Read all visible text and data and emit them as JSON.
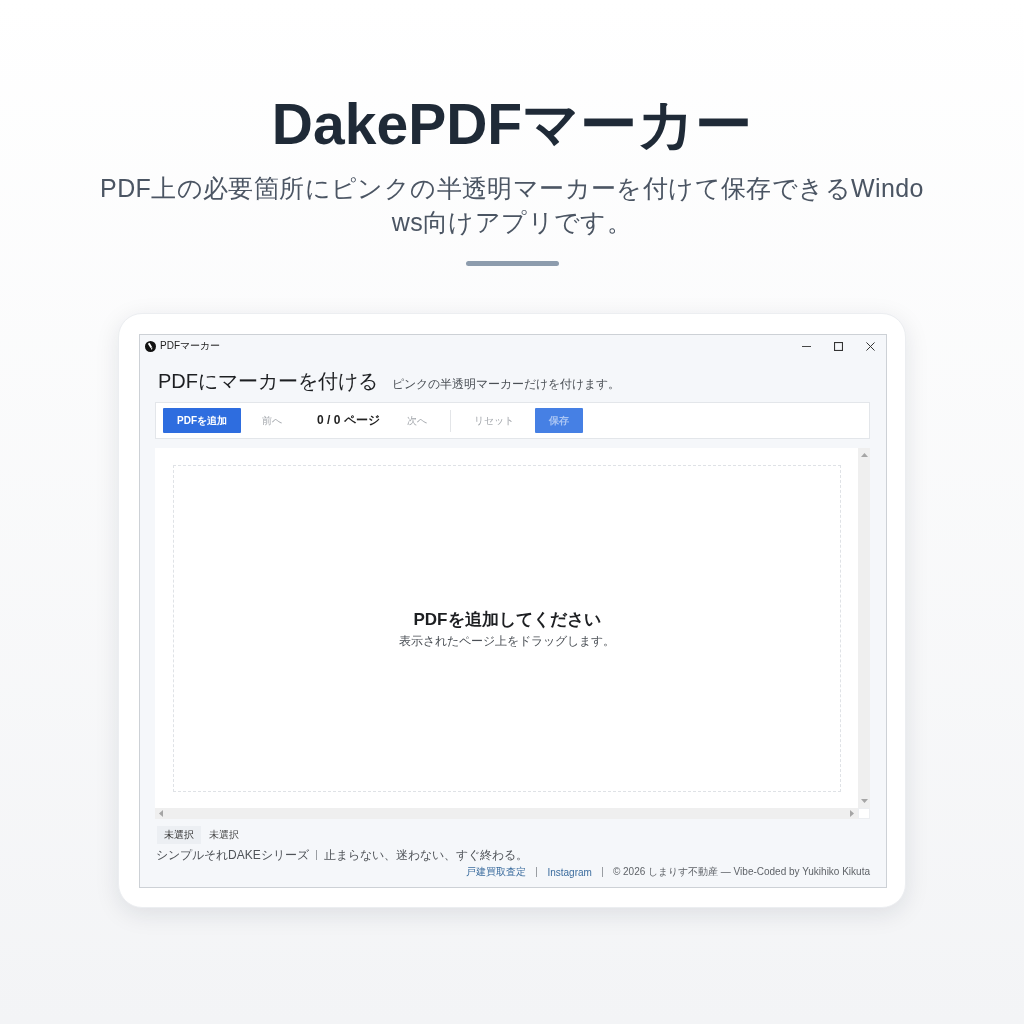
{
  "hero": {
    "title": "DakePDFマーカー",
    "subtitle": "PDF上の必要箇所にピンクの半透明マーカーを付けて保存できるWindows向けアプリです。"
  },
  "window": {
    "title": "PDFマーカー",
    "controls": [
      {
        "kind": "minimize"
      },
      {
        "kind": "maximize"
      },
      {
        "kind": "close"
      }
    ]
  },
  "header": {
    "title": "PDFにマーカーを付ける",
    "subtitle": "ピンクの半透明マーカーだけを付けます。"
  },
  "toolbar": [
    {
      "kind": "primary",
      "label": "PDFを追加",
      "disabled": false
    },
    {
      "kind": "text",
      "label": "前へ",
      "disabled": true
    },
    {
      "kind": "counter",
      "label": "0 / 0 ページ"
    },
    {
      "kind": "text",
      "label": "次へ",
      "disabled": true
    },
    {
      "kind": "separator"
    },
    {
      "kind": "text",
      "label": "リセット",
      "disabled": true
    },
    {
      "kind": "primary",
      "label": "保存",
      "disabled": true
    }
  ],
  "viewer": {
    "empty_title": "PDFを追加してください",
    "empty_hint": "表示されたページ上をドラッグします。"
  },
  "status": [
    {
      "kind": "badge",
      "text": "未選択"
    },
    {
      "kind": "plain",
      "text": "未選択"
    }
  ],
  "footer": {
    "left": [
      "シンプルそれDAKEシリーズ",
      "止まらない、迷わない、すぐ終わる。"
    ],
    "links": [
      "戸建買取査定",
      "Instagram"
    ],
    "copyright": "© 2026 しまりす不動産 — Vibe-Coded by Yukihiko Kikuta"
  }
}
